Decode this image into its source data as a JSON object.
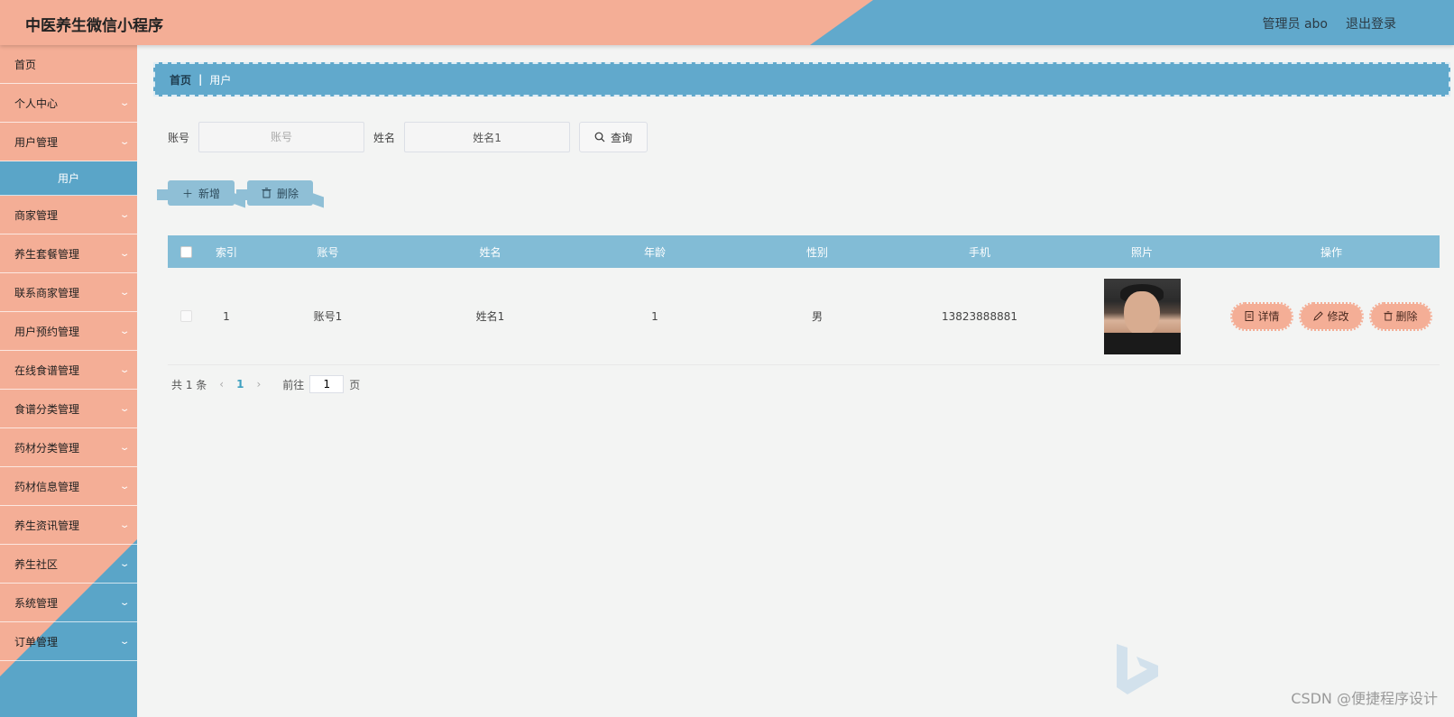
{
  "header": {
    "title": "中医养生微信小程序",
    "admin_label": "管理员 abo",
    "logout_label": "退出登录"
  },
  "sidebar": {
    "items": [
      {
        "label": "首页"
      },
      {
        "label": "个人中心"
      },
      {
        "label": "用户管理"
      },
      {
        "label": "用户"
      },
      {
        "label": "商家管理"
      },
      {
        "label": "养生套餐管理"
      },
      {
        "label": "联系商家管理"
      },
      {
        "label": "用户预约管理"
      },
      {
        "label": "在线食谱管理"
      },
      {
        "label": "食谱分类管理"
      },
      {
        "label": "药材分类管理"
      },
      {
        "label": "药材信息管理"
      },
      {
        "label": "养生资讯管理"
      },
      {
        "label": "养生社区"
      },
      {
        "label": "系统管理"
      },
      {
        "label": "订单管理"
      }
    ]
  },
  "breadcrumb": {
    "home": "首页",
    "current": "用户"
  },
  "search": {
    "account_label": "账号",
    "account_placeholder": "账号",
    "account_value": "",
    "name_label": "姓名",
    "name_value": "姓名1",
    "query_label": "查询"
  },
  "actions": {
    "add_label": "新增",
    "delete_label": "删除"
  },
  "table": {
    "headers": [
      "索引",
      "账号",
      "姓名",
      "年龄",
      "性别",
      "手机",
      "照片",
      "操作"
    ],
    "rows": [
      {
        "index": "1",
        "account": "账号1",
        "name": "姓名1",
        "age": "1",
        "sex": "男",
        "phone": "13823888881",
        "ops": {
          "detail": "详情",
          "edit": "修改",
          "delete": "删除"
        }
      }
    ]
  },
  "pagination": {
    "total": "共 1 条",
    "current_page": "1",
    "goto_label": "前往",
    "goto_value": "1",
    "page_suffix": "页"
  },
  "watermark": "CSDN @便捷程序设计",
  "colors": {
    "salmon": "#f4ae96",
    "blue": "#61a9cc",
    "table_header": "#82bcd6"
  }
}
